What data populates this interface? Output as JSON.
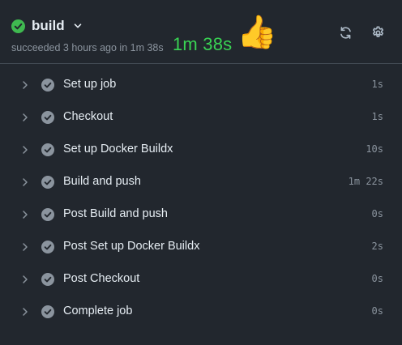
{
  "header": {
    "job_name": "build",
    "status_text": "succeeded 3 hours ago in 1m 38s",
    "duration_highlight": "1m 38s",
    "status_icon": "check-circle-fill-icon",
    "refresh_icon": "sync-icon",
    "settings_icon": "gear-icon",
    "reaction_emoji": "👍"
  },
  "colors": {
    "background": "#22272e",
    "success": "#3fb950",
    "highlight_text": "#39d353",
    "step_check": "#8b949e"
  },
  "steps": [
    {
      "label": "Set up job",
      "time": "1s"
    },
    {
      "label": "Checkout",
      "time": "1s"
    },
    {
      "label": "Set up Docker Buildx",
      "time": "10s"
    },
    {
      "label": "Build and push",
      "time": "1m 22s"
    },
    {
      "label": "Post Build and push",
      "time": "0s"
    },
    {
      "label": "Post Set up Docker Buildx",
      "time": "2s"
    },
    {
      "label": "Post Checkout",
      "time": "0s"
    },
    {
      "label": "Complete job",
      "time": "0s"
    }
  ]
}
